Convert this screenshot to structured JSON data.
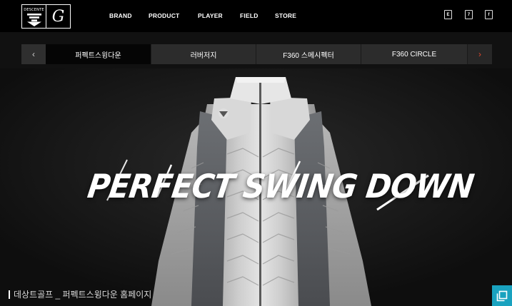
{
  "header": {
    "logo_brand": "DESCENTE",
    "logo_mark": "G",
    "nav": [
      "BRAND",
      "PRODUCT",
      "PLAYER",
      "FIELD",
      "STORE"
    ],
    "util_icons": [
      "bag-icon",
      "calendar-icon",
      "facebook-icon"
    ],
    "util_labels": [
      "E",
      "7",
      "f"
    ]
  },
  "tabs": {
    "prev_icon": "‹",
    "next_icon": "›",
    "items": [
      "퍼펙트스윙다운",
      "러버저지",
      "F360 스메시펙터",
      "F360 CIRCLE"
    ],
    "active_index": 0
  },
  "hero": {
    "headline": "PERFECT SWING DOWN",
    "caption": "데상트골프 _ 퍼펙트스윙다운 홈페이지"
  },
  "colors": {
    "accent": "#e0472b",
    "corner_button": "#19a2bf",
    "header_bg": "#000000"
  }
}
